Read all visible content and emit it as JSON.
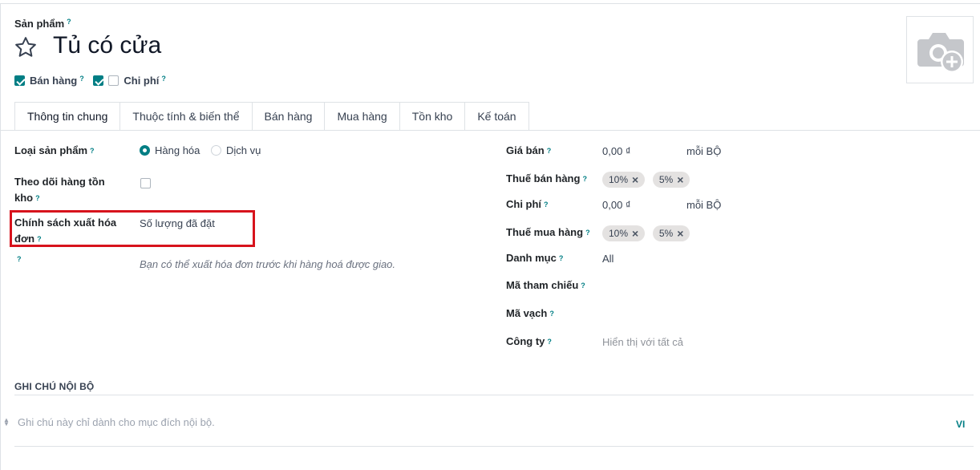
{
  "header": {
    "breadcrumb": "Sản phẩm",
    "help_mark": "?",
    "product_name": "Tủ có cửa",
    "options": [
      {
        "label": "Bán hàng",
        "checked": true
      },
      {
        "label": "Chi phí",
        "checked": false
      }
    ]
  },
  "tabs": [
    "Thông tin chung",
    "Thuộc tính & biến thể",
    "Bán hàng",
    "Mua hàng",
    "Tồn kho",
    "Kế toán"
  ],
  "left": {
    "product_type_label": "Loại sản phẩm",
    "product_type_options": [
      "Hàng hóa",
      "Dịch vụ"
    ],
    "product_type_selected": "Hàng hóa",
    "track_inventory_label_1": "Theo dõi hàng tồn",
    "track_inventory_label_2": "kho",
    "invoice_policy_label_1": "Chính sách xuất hóa",
    "invoice_policy_label_2": "đơn",
    "invoice_policy_value": "Số lượng đã đặt",
    "invoice_hint": "Bạn có thể xuất hóa đơn trước khi hàng hoá được giao."
  },
  "right": {
    "sale_price_label": "Giá bán",
    "sale_price_value": "0,00 ₫",
    "sale_price_unit": "mỗi BỘ",
    "sale_tax_label": "Thuế bán hàng",
    "sale_taxes": [
      "10%",
      "5%"
    ],
    "cost_label": "Chi phí",
    "cost_value": "0,00 ₫",
    "cost_unit": "mỗi BỘ",
    "purchase_tax_label": "Thuế mua hàng",
    "purchase_taxes": [
      "10%",
      "5%"
    ],
    "category_label": "Danh mục",
    "category_value": "All",
    "reference_label": "Mã tham chiếu",
    "barcode_label": "Mã vạch",
    "company_label": "Công ty",
    "company_placeholder": "Hiển thị với tất cả"
  },
  "notes": {
    "title": "GHI CHÚ NỘI BỘ",
    "placeholder": "Ghi chú này chỉ dành cho mục đích nội bộ.",
    "lang": "VI"
  },
  "colors": {
    "accent": "#017e84",
    "highlight": "#d7131c",
    "tag_bg": "#e4e2e1"
  }
}
